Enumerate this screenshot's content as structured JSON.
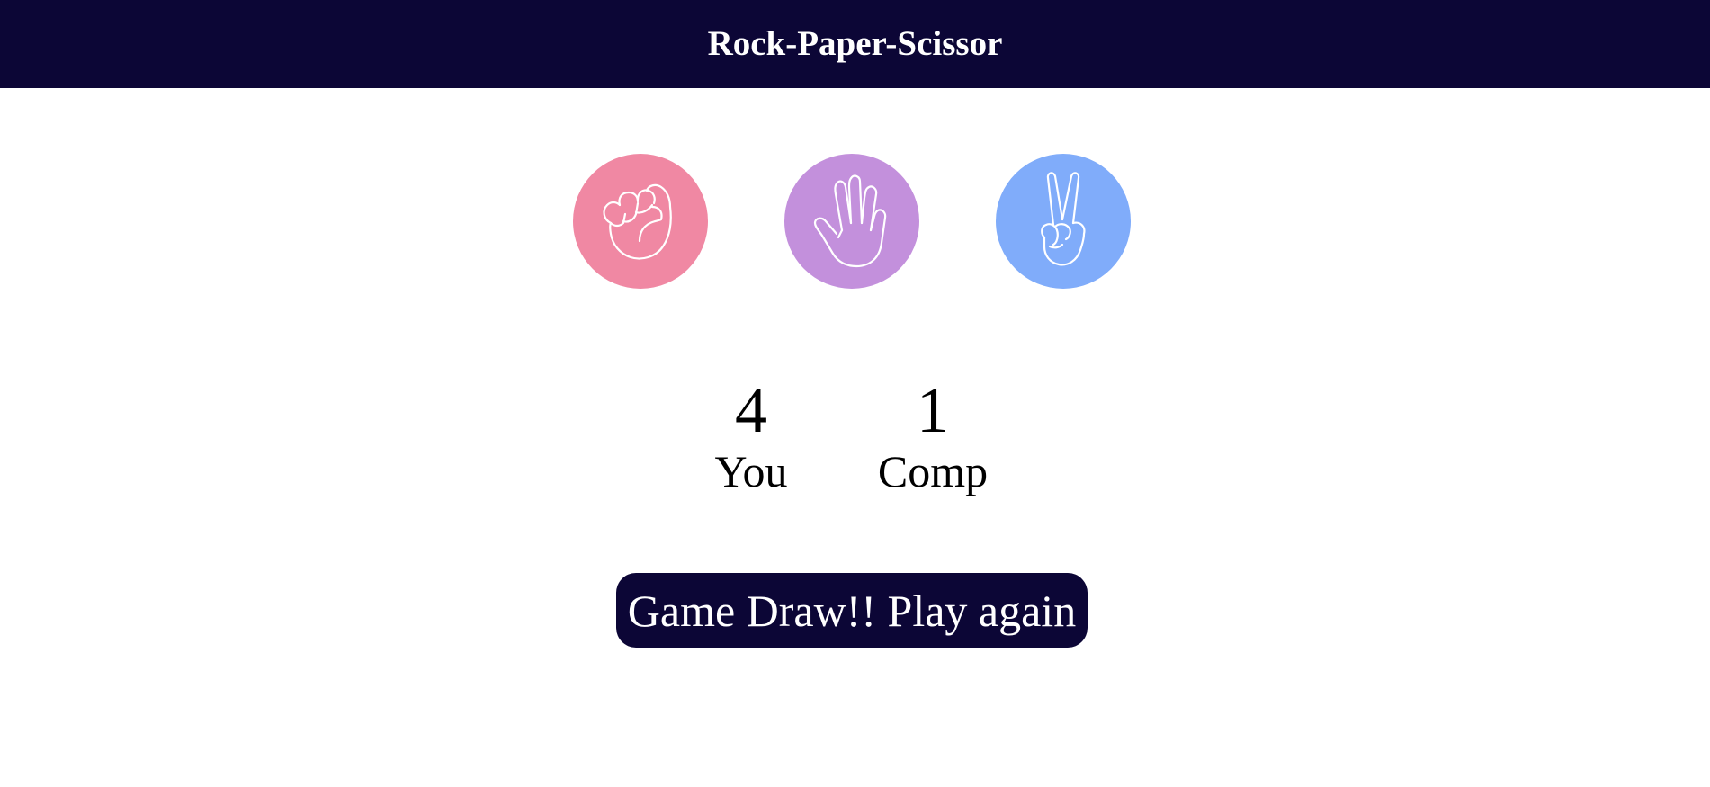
{
  "header": {
    "title": "Rock-Paper-Scissor"
  },
  "choices": [
    {
      "id": "rock",
      "icon": "rock-fist-icon",
      "color": "#f088a3"
    },
    {
      "id": "paper",
      "icon": "paper-hand-icon",
      "color": "#c390dc"
    },
    {
      "id": "scissors",
      "icon": "scissors-hand-icon",
      "color": "#80acfa"
    }
  ],
  "scoreboard": {
    "user": {
      "score": "4",
      "label": "You"
    },
    "comp": {
      "score": "1",
      "label": "Comp"
    }
  },
  "message": {
    "text": "Game Draw!! Play again"
  },
  "colors": {
    "header_bg": "#0c0636",
    "message_bg": "#0c0636",
    "text_light": "#ffffff"
  }
}
